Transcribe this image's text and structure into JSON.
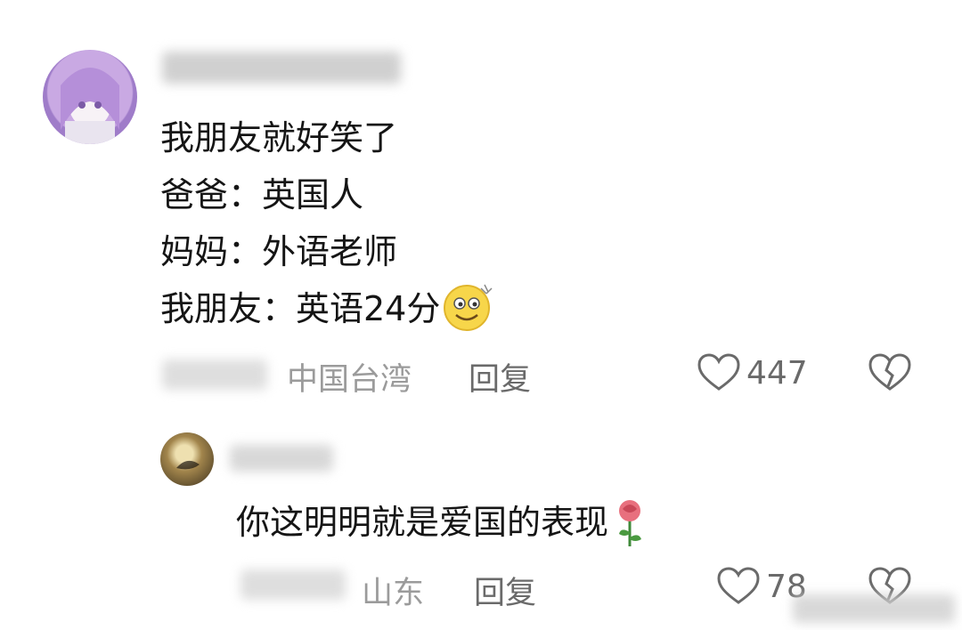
{
  "comment": {
    "lines": [
      "我朋友就好笑了",
      "爸爸：英国人",
      "妈妈：外语老师",
      "我朋友：英语24分"
    ],
    "emoji": "smirk-emoji",
    "location": "中国台湾",
    "reply_label": "回复",
    "like_count": "447"
  },
  "reply": {
    "text": "你这明明就是爱国的表现",
    "emoji": "rose-emoji",
    "location": "山东",
    "reply_label": "回复",
    "like_count": "78"
  },
  "colors": {
    "meta": "#9b9b9b",
    "text": "#151515",
    "icon": "#6a6a6a"
  }
}
